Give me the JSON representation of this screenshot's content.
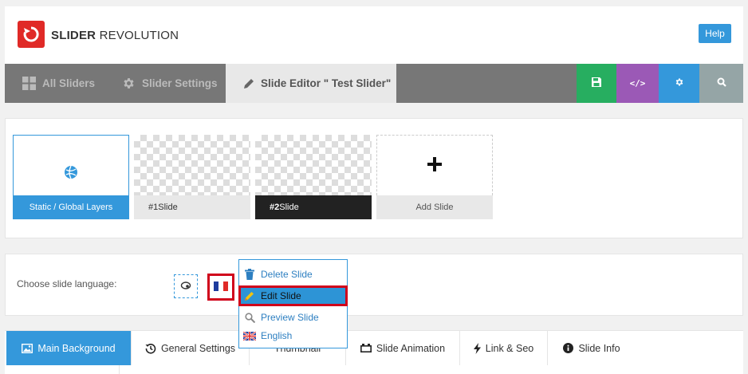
{
  "header": {
    "logo_bold": "SLIDER",
    "logo_light": " REVOLUTION",
    "help_label": "Help"
  },
  "navbar": {
    "tabs": [
      {
        "label": "All Sliders",
        "icon": "grid-icon"
      },
      {
        "label": "Slider Settings",
        "icon": "gear-icon"
      },
      {
        "label": "Slide Editor \" Test Slider\"",
        "icon": "pencil-icon"
      }
    ],
    "buttons": [
      {
        "icon": "save-icon",
        "color": "#27ae60"
      },
      {
        "icon": "code-icon",
        "color": "#9b59b6"
      },
      {
        "icon": "gear-icon",
        "color": "#3498db"
      },
      {
        "icon": "search-icon",
        "color": "#95a5a6"
      }
    ]
  },
  "slides": {
    "items": [
      {
        "label": "Static / Global Layers"
      },
      {
        "label_num": "#1",
        "label_text": " Slide"
      },
      {
        "label_num": "#2",
        "label_text": " Slide"
      },
      {
        "label": "Add Slide"
      }
    ]
  },
  "language": {
    "label": "Choose slide language:"
  },
  "context_menu": {
    "items": [
      {
        "label": "Delete Slide",
        "icon": "trash-icon"
      },
      {
        "label": "Edit Slide",
        "icon": "pencil-icon"
      },
      {
        "label": "Preview Slide",
        "icon": "magnifier-icon"
      },
      {
        "label": "English",
        "icon": "uk-flag-icon"
      }
    ]
  },
  "bottom_tabs": [
    {
      "label": "Main Background",
      "icon": "image-icon"
    },
    {
      "label": "General Settings",
      "icon": "history-icon"
    },
    {
      "label": "Thumbnail",
      "icon": ""
    },
    {
      "label": "Slide Animation",
      "icon": "animation-icon"
    },
    {
      "label": "Link & Seo",
      "icon": "bolt-icon"
    },
    {
      "label": "Slide Info",
      "icon": "info-icon"
    }
  ],
  "colors": {
    "accent": "#3498db",
    "brand_red": "#e02a27",
    "highlight": "#d0021b"
  }
}
